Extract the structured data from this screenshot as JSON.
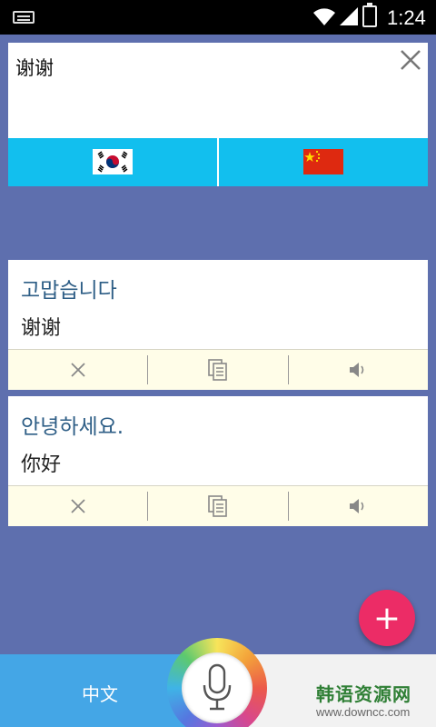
{
  "status_bar": {
    "time": "1:24",
    "icons": [
      "keyboard-icon",
      "wifi-icon",
      "signal-icon",
      "battery-icon"
    ]
  },
  "input_card": {
    "text": "谢谢",
    "clear_icon": "close-icon",
    "source_flag": "korea-flag-icon",
    "target_flag": "china-flag-icon"
  },
  "translations": [
    {
      "korean": "고맙습니다",
      "chinese": "谢谢"
    },
    {
      "korean": "안녕하세요.",
      "chinese": "你好"
    }
  ],
  "card_actions": [
    "delete-icon",
    "copy-icon",
    "speaker-icon"
  ],
  "fab": {
    "icon": "plus-icon",
    "label": "+"
  },
  "bottom_bar": {
    "left_language": "中文",
    "mic_icon": "microphone-icon",
    "watermark": {
      "title": "韩语资源网",
      "url": "www.downcc.com"
    }
  },
  "colors": {
    "background": "#5e6fae",
    "lang_bar": "#12bfee",
    "korean_text": "#2e5e86",
    "action_bar": "#fffde8",
    "fab": "#ec2c66",
    "bottom_left": "#44a6e6"
  }
}
